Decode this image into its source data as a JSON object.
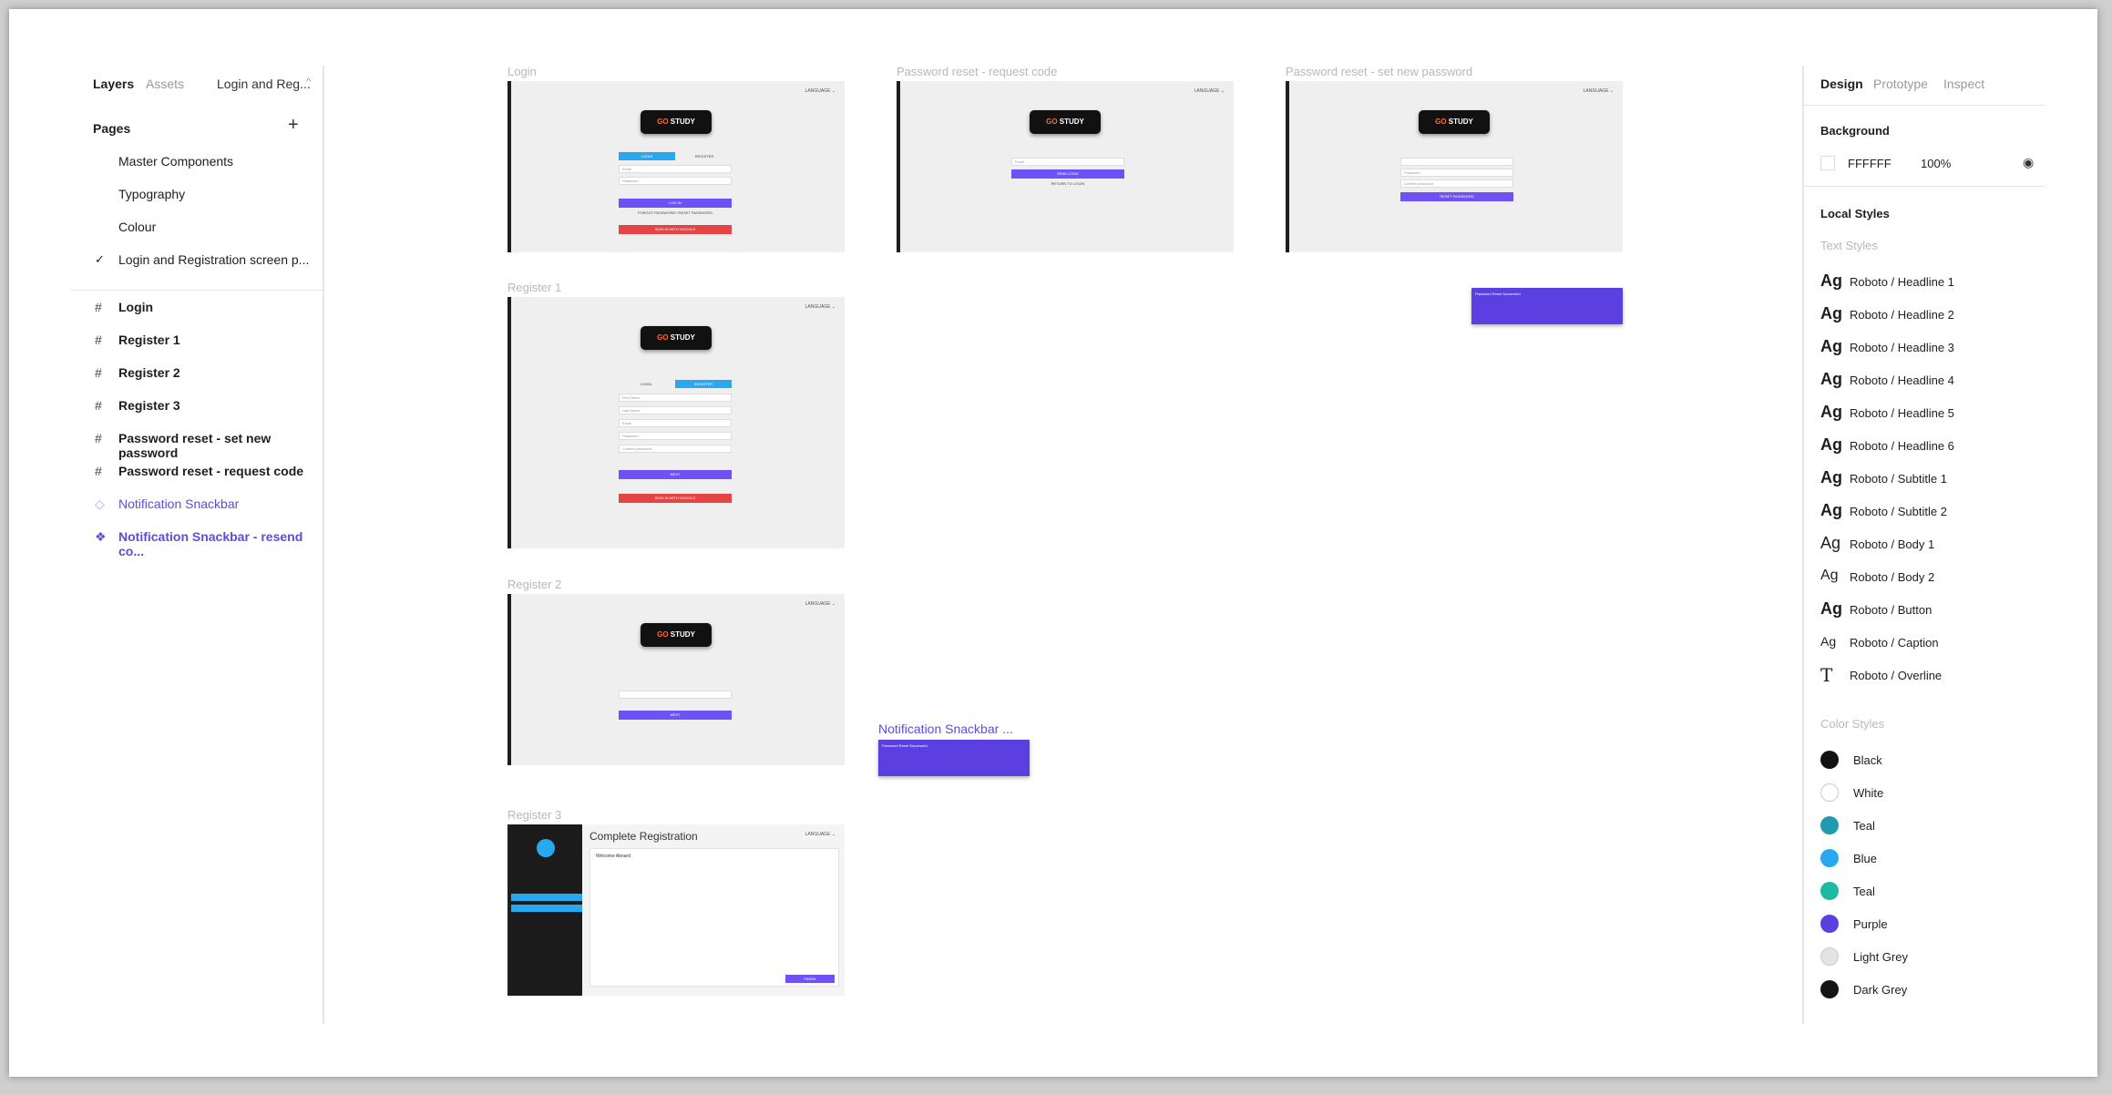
{
  "left_panel": {
    "tabs": {
      "layers": "Layers",
      "assets": "Assets",
      "file": "Login and Reg...",
      "chevron": "^"
    },
    "pages_title": "Pages",
    "add_icon": "+",
    "pages": [
      "Master Components",
      "Typography",
      "Colour",
      "Login and Registration screen p..."
    ],
    "check_icon": "✓",
    "layers": [
      "Login",
      "Register 1",
      "Register 2",
      "Register 3",
      "Password reset - set new password",
      "Password reset - request code"
    ],
    "frame_icon": "#",
    "components": [
      "Notification Snackbar",
      "Notification Snackbar - resend co..."
    ],
    "component_icon": "◇",
    "instance_icon": "❖"
  },
  "canvas": {
    "frames": {
      "login": "Login",
      "pw_request": "Password reset - request code",
      "pw_new": "Password reset - set new password",
      "register1": "Register 1",
      "register2": "Register 2",
      "register3": "Register 3",
      "snackbar": "Notification Snackbar ..."
    },
    "mock": {
      "lang": "LANGUAGE ⌄",
      "logo_a": "GO",
      "logo_b": "STUDY",
      "login_tab": "LOGIN",
      "register_tab": "REGISTER",
      "email": "Email",
      "password": "Password",
      "login_btn": "LOG IN",
      "forgot": "FORGOT PASSWORD? RESET PASSWORD",
      "google": "SIGN IN WITH GOOGLE",
      "send_code": "SEND CODE",
      "back_login": "RETURN TO LOGIN",
      "reset_btn": "RESET PASSWORD",
      "first_name": "First Name",
      "last_name": "Last Name",
      "confirm": "Confirm password",
      "next_btn": "NEXT",
      "complete_title": "Complete Registration",
      "welcome": "Welcome Aboard",
      "finish_btn": "FINISH",
      "snack_text": "Password Reset Successful"
    }
  },
  "right_panel": {
    "tabs": {
      "design": "Design",
      "prototype": "Prototype",
      "inspect": "Inspect"
    },
    "background_title": "Background",
    "bg_hex": "FFFFFF",
    "bg_opacity": "100%",
    "eye_icon": "◉",
    "local_styles": "Local Styles",
    "text_styles_title": "Text Styles",
    "ag": "Ag",
    "overline_glyph": "T",
    "text_styles": [
      "Roboto / Headline 1",
      "Roboto / Headline 2",
      "Roboto / Headline 3",
      "Roboto / Headline 4",
      "Roboto / Headline 5",
      "Roboto / Headline 6",
      "Roboto / Subtitle 1",
      "Roboto / Subtitle 2",
      "Roboto / Body 1",
      "Roboto / Body 2",
      "Roboto / Button",
      "Roboto / Caption",
      "Roboto / Overline"
    ],
    "color_styles_title": "Color Styles",
    "color_styles": [
      {
        "name": "Black",
        "color": "#111111"
      },
      {
        "name": "White",
        "color": "#ffffff"
      },
      {
        "name": "Teal",
        "color": "#1f9ab0"
      },
      {
        "name": "Blue",
        "color": "#29a8f2"
      },
      {
        "name": "Teal",
        "color": "#1fb8a4"
      },
      {
        "name": "Purple",
        "color": "#5b3fe0"
      },
      {
        "name": "Light Grey",
        "color": "#e3e3e3"
      },
      {
        "name": "Dark Grey",
        "color": "#151515"
      }
    ]
  }
}
